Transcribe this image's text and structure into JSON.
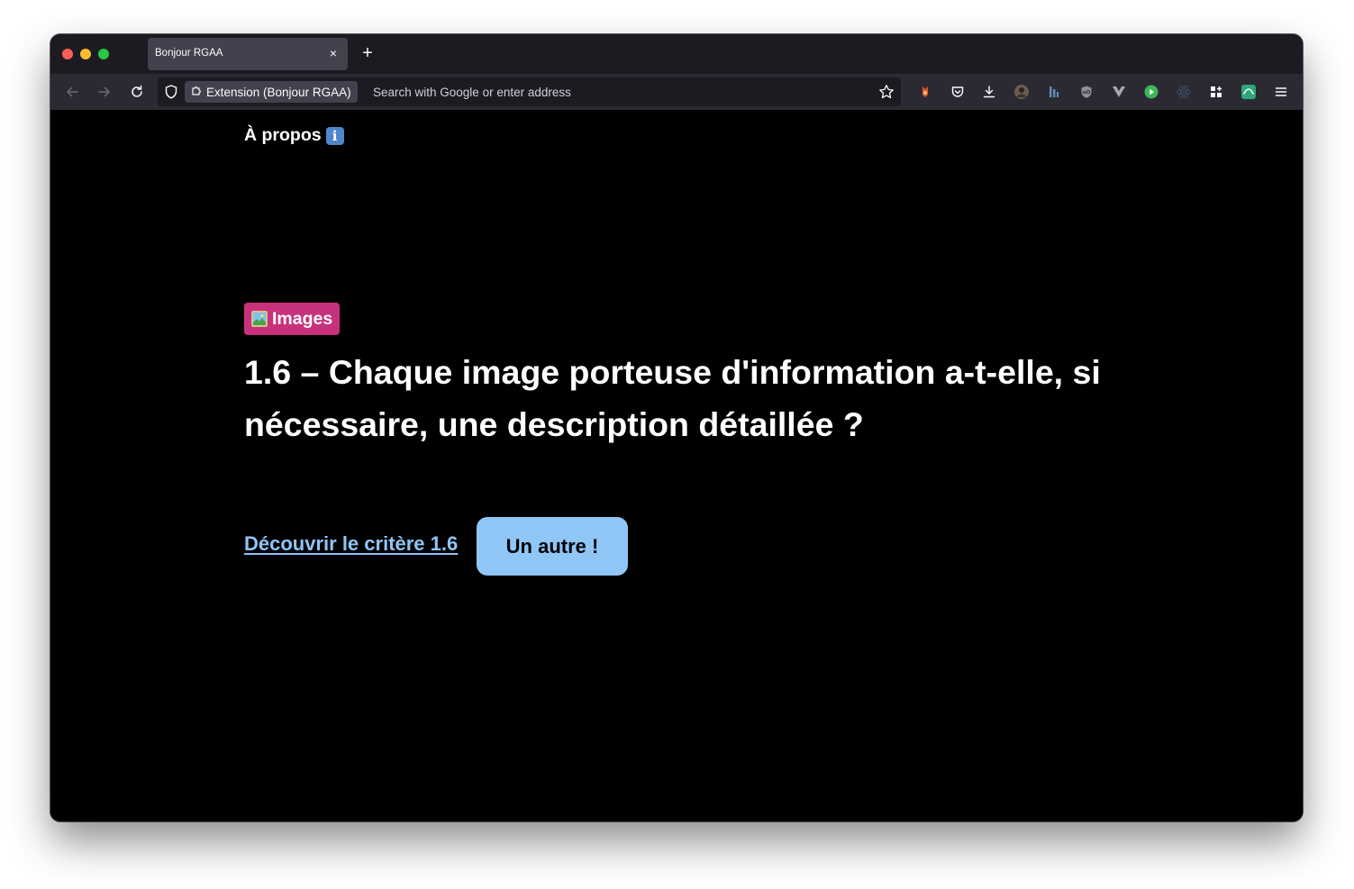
{
  "browser": {
    "tab": {
      "title": "Bonjour RGAA",
      "close_glyph": "×"
    },
    "new_tab_glyph": "+",
    "urlbar": {
      "identity_label": "Extension (Bonjour RGAA)",
      "placeholder": "Search with Google or enter address",
      "value": ""
    },
    "icons": {
      "back": "back-arrow-icon",
      "forward": "forward-arrow-icon",
      "reload": "reload-icon",
      "tracking_protection": "shield-icon",
      "extension": "puzzle-icon",
      "bookmark": "star-icon",
      "toolbar": [
        "fox-extension-icon",
        "pocket-icon",
        "download-icon",
        "profile-avatar-icon",
        "bars-extension-icon",
        "ublock-origin-icon",
        "vuejs-devtools-icon",
        "play-extension-icon",
        "react-devtools-icon",
        "grid-extension-icon",
        "green-extension-icon",
        "menu-icon"
      ]
    },
    "colors": {
      "tab_strip": "#1c1b22",
      "nav_bar": "#2b2a33",
      "url_field": "#1c1b22",
      "selected_tab": "#42414d"
    }
  },
  "page": {
    "about_label": "À propos",
    "about_emoji": "i",
    "category_label": "Images",
    "criterion_title": "1.6 – Chaque image porteuse d'information a-t-elle, si nécessaire, une description détaillée ?",
    "discover_link_label": "Découvrir le critère 1.6",
    "another_button_label": "Un autre !",
    "colors": {
      "background": "#000000",
      "text": "#ffffff",
      "category_badge": "#c8317c",
      "link": "#8fc4f7",
      "button": "#8fc6f6"
    }
  }
}
